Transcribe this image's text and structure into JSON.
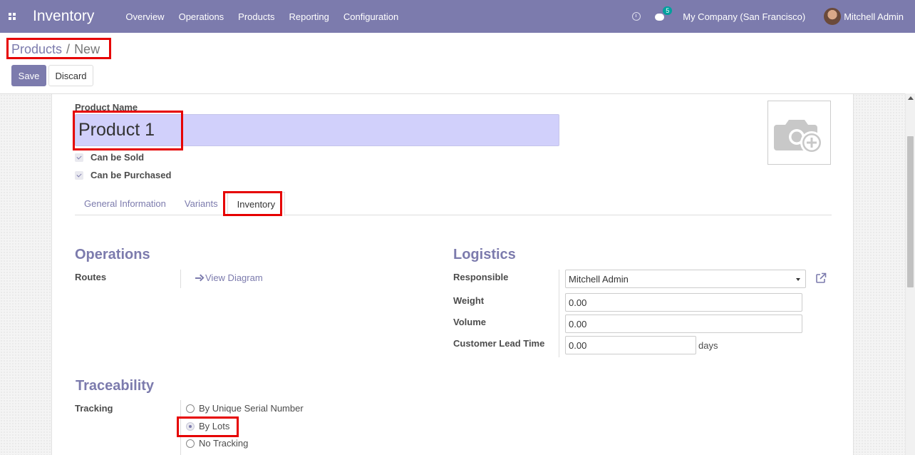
{
  "navbar": {
    "app_name": "Inventory",
    "menu": [
      "Overview",
      "Operations",
      "Products",
      "Reporting",
      "Configuration"
    ],
    "chat_count": "5",
    "company": "My Company (San Francisco)",
    "user": "Mitchell Admin"
  },
  "breadcrumb": {
    "parent": "Products",
    "separator": "/",
    "current": "New"
  },
  "buttons": {
    "save": "Save",
    "discard": "Discard"
  },
  "form": {
    "product_name_label": "Product Name",
    "product_name_value": "Product 1",
    "can_be_sold": "Can be Sold",
    "can_be_purchased": "Can be Purchased"
  },
  "tabs": [
    "General Information",
    "Variants",
    "Inventory"
  ],
  "active_tab": "Inventory",
  "operations": {
    "title": "Operations",
    "routes_label": "Routes",
    "view_diagram": "View Diagram"
  },
  "logistics": {
    "title": "Logistics",
    "responsible_label": "Responsible",
    "responsible_value": "Mitchell Admin",
    "weight_label": "Weight",
    "weight_value": "0.00",
    "volume_label": "Volume",
    "volume_value": "0.00",
    "lead_time_label": "Customer Lead Time",
    "lead_time_value": "0.00",
    "lead_time_unit": "days"
  },
  "traceability": {
    "title": "Traceability",
    "tracking_label": "Tracking",
    "options": [
      "By Unique Serial Number",
      "By Lots",
      "No Tracking"
    ],
    "selected": "By Lots"
  },
  "colors": {
    "brand": "#7c7bad",
    "highlight": "#e60000",
    "input_focus": "#d1d0fb"
  }
}
